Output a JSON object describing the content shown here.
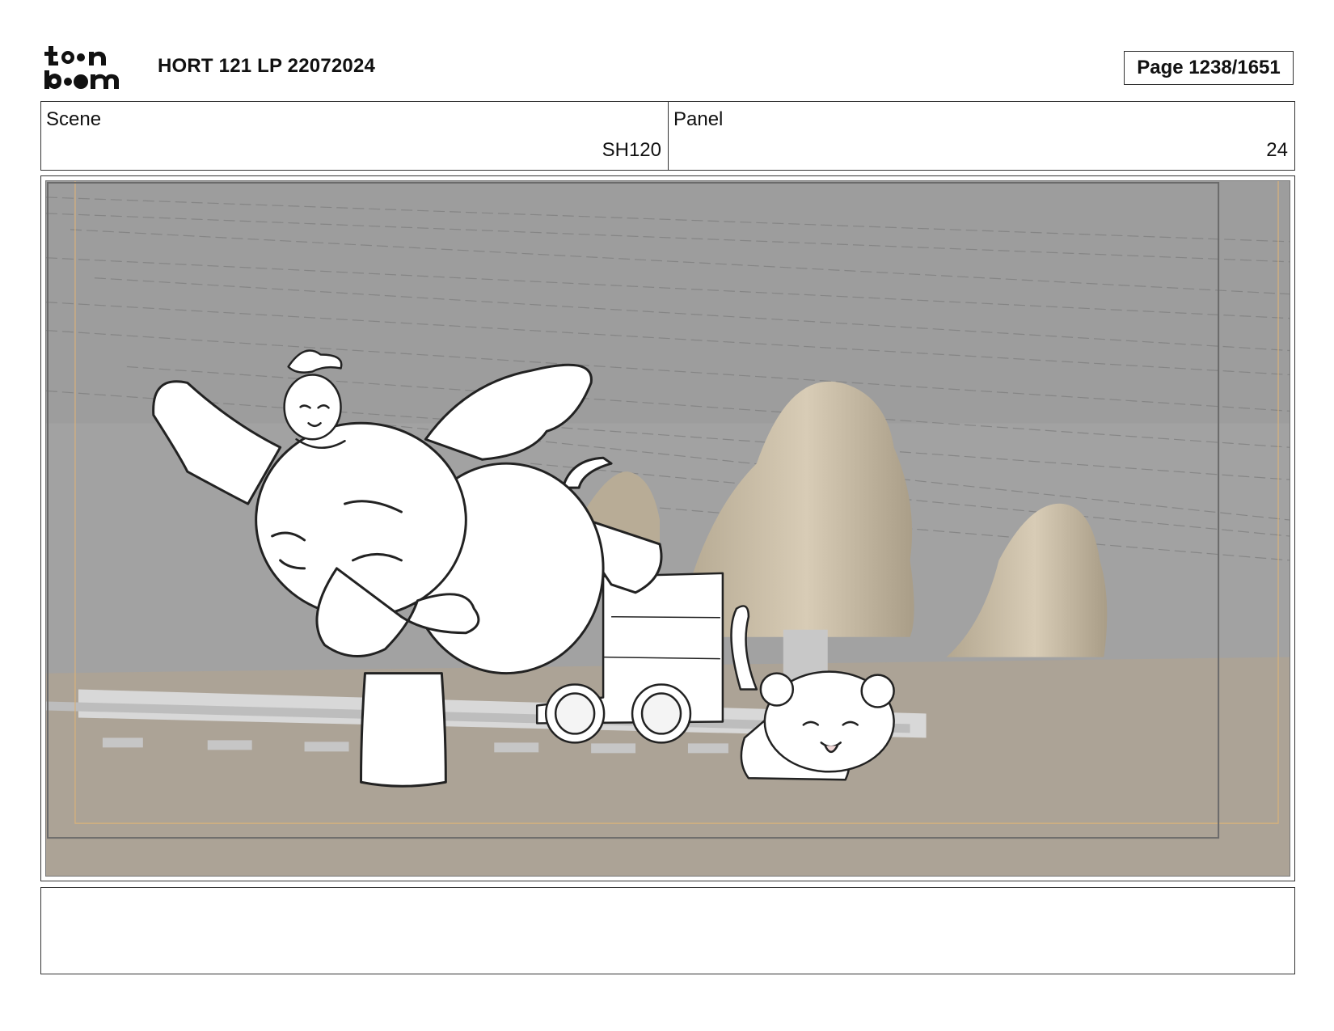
{
  "header": {
    "logo_text": "toon boom",
    "title": "HORT 121 LP 22072024",
    "page_label": "Page 1238/1651"
  },
  "info": {
    "scene_label": "Scene",
    "scene_value": "SH120",
    "panel_label": "Panel",
    "panel_value": "24"
  },
  "notes": {
    "text": ""
  }
}
